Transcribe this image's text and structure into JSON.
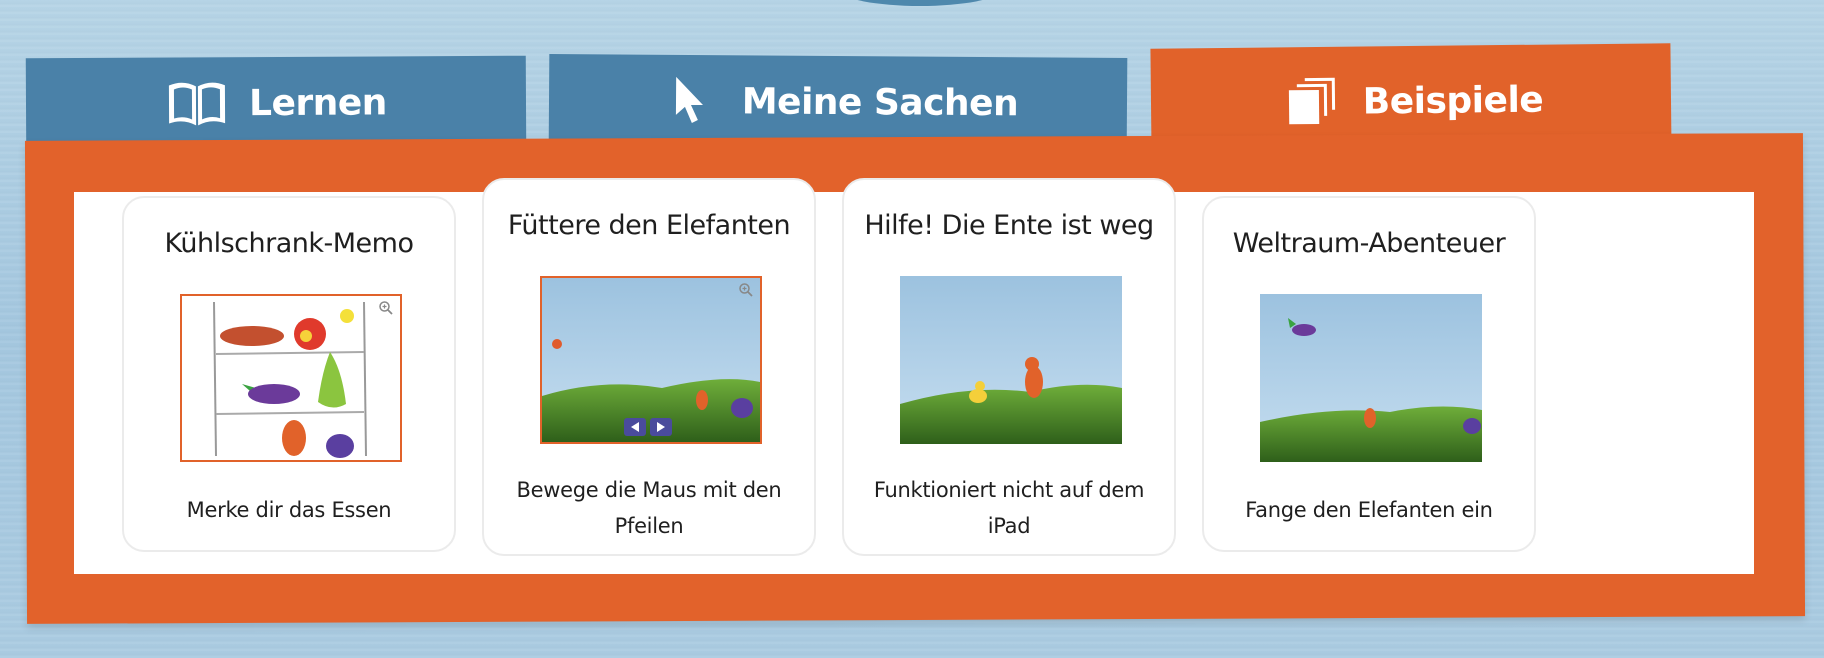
{
  "tabs": [
    {
      "label": "Lernen",
      "icon": "book-icon",
      "active": false
    },
    {
      "label": "Meine Sachen",
      "icon": "cursor-arrow-icon",
      "active": false
    },
    {
      "label": "Beispiele",
      "icon": "stacked-pages-icon",
      "active": true
    }
  ],
  "colors": {
    "tab_inactive": "#4a81a8",
    "accent_orange": "#e1622a",
    "background_water": "#a4c7df",
    "card_border": "#ebebeb"
  },
  "examples": [
    {
      "title": "Kühlschrank-Memo",
      "description": "Merke dir das Essen",
      "thumbnail": "fridge-memo-thumbnail",
      "zoom": true
    },
    {
      "title": "Füttere den Elefanten",
      "description": "Bewege die Maus mit den Pfeilen",
      "thumbnail": "feed-elephant-thumbnail",
      "zoom": true
    },
    {
      "title": "Hilfe! Die Ente ist weg",
      "description": "Funktioniert nicht auf dem iPad",
      "thumbnail": "duck-missing-thumbnail",
      "zoom": false
    },
    {
      "title": "Weltraum-Abenteuer",
      "description": "Fange den Elefanten ein",
      "thumbnail": "space-adventure-thumbnail",
      "zoom": false
    }
  ]
}
